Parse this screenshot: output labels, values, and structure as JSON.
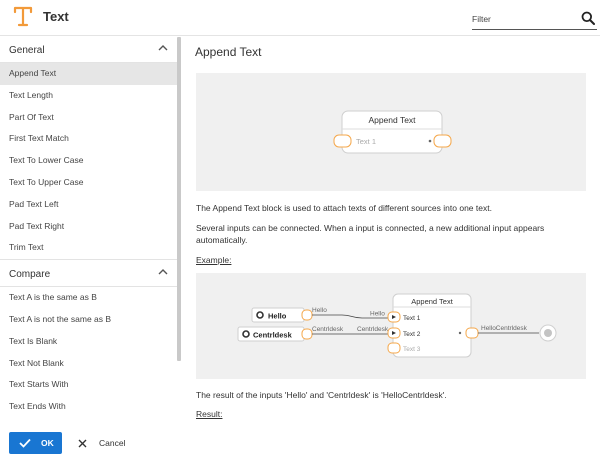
{
  "header": {
    "title": "Text",
    "filter_placeholder": "Filter"
  },
  "sidebar": {
    "groups": [
      {
        "label": "General",
        "items": [
          "Append Text",
          "Text Length",
          "Part Of Text",
          "First Text Match",
          "Text To Lower Case",
          "Text To Upper Case",
          "Pad Text Left",
          "Pad Text Right",
          "Trim Text"
        ]
      },
      {
        "label": "Compare",
        "items": [
          "Text A is the same as B",
          "Text A is not the same as B",
          "Text Is Blank",
          "Text Not Blank",
          "Text Starts With",
          "Text Ends With"
        ]
      }
    ],
    "selected_item": "Append Text"
  },
  "footer": {
    "ok_label": "OK",
    "cancel_label": "Cancel"
  },
  "content": {
    "title": "Append Text",
    "diagram1": {
      "block_title": "Append Text",
      "input_label": "Text 1"
    },
    "description": "The Append Text block is used to attach texts of different sources into one text.",
    "description2": "Several inputs can be connected. When a input is connected, a new additional input appears automatically.",
    "example_label": "Example:",
    "diagram2": {
      "source1": "Hello",
      "source2": "Centrldesk",
      "wire1_out": "Hello",
      "wire1_in": "Hello",
      "wire2_out": "Centrldesk",
      "wire2_in": "Centrldesk",
      "block_title": "Append Text",
      "input1": "Text 1",
      "input2": "Text 2",
      "input3": "Text 3",
      "output_value": "HelloCentrldesk"
    },
    "result_text": "The result of the inputs 'Hello' and 'Centrldesk' is 'HelloCentrldesk'.",
    "result_label": "Result:"
  },
  "colors": {
    "accent": "#1976d2",
    "port_orange": "#f5a74a",
    "icon_orange": "#f29a3a"
  }
}
